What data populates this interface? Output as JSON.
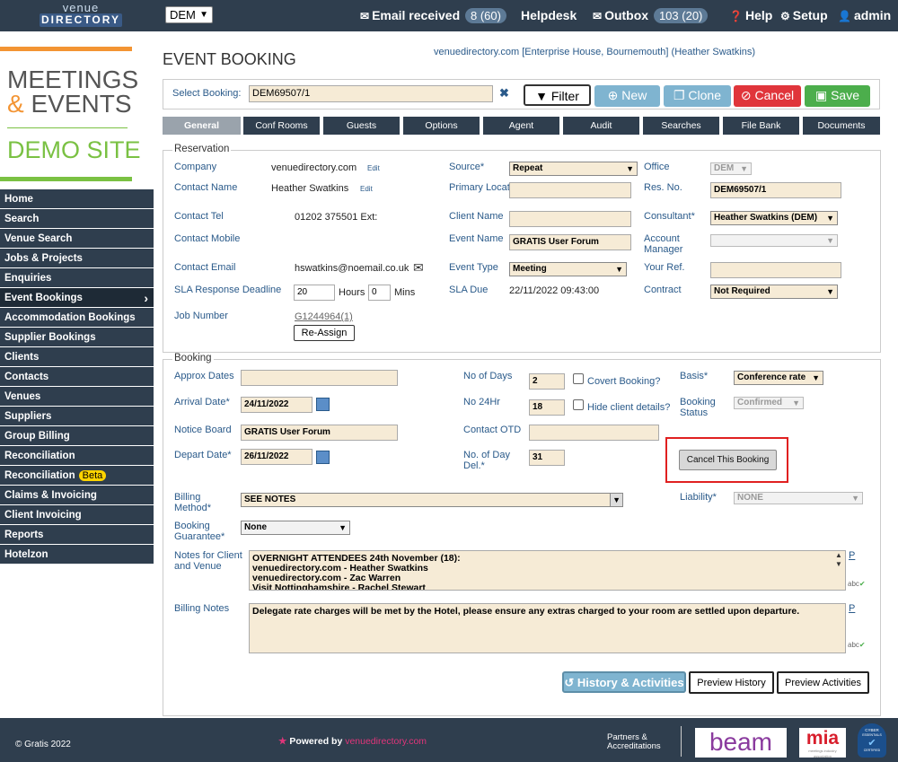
{
  "topbar": {
    "logo_line1": "venue",
    "logo_line2": "DIRECTORY",
    "site_select": "DEM",
    "email_label": "Email received",
    "email_count": "8 (60)",
    "helpdesk": "Helpdesk",
    "outbox_label": "Outbox",
    "outbox_count": "103 (20)",
    "help": "Help",
    "setup": "Setup",
    "admin": "admin"
  },
  "brand": {
    "line1": "MEETINGS",
    "amp": "&",
    "line2": "EVENTS",
    "demo": "DEMO SITE"
  },
  "sidebar": {
    "items": [
      {
        "label": "Home"
      },
      {
        "label": "Search"
      },
      {
        "label": "Venue Search"
      },
      {
        "label": "Jobs & Projects"
      },
      {
        "label": "Enquiries"
      },
      {
        "label": "Event Bookings"
      },
      {
        "label": "Accommodation Bookings"
      },
      {
        "label": "Supplier Bookings"
      },
      {
        "label": "Clients"
      },
      {
        "label": "Contacts"
      },
      {
        "label": "Venues"
      },
      {
        "label": "Suppliers"
      },
      {
        "label": "Group Billing"
      },
      {
        "label": "Reconciliation"
      },
      {
        "label": "Reconciliation"
      },
      {
        "label": "Claims & Invoicing"
      },
      {
        "label": "Client Invoicing"
      },
      {
        "label": "Reports"
      },
      {
        "label": "Hotelzon"
      }
    ],
    "beta": "Beta"
  },
  "page": {
    "title": "EVENT BOOKING",
    "location": "venuedirectory.com [Enterprise House, Bournemouth] (Heather Swatkins)"
  },
  "selbar": {
    "label": "Select Booking:",
    "value": "DEM69507/1",
    "filter": "Filter",
    "new": "New",
    "clone": "Clone",
    "cancel": "Cancel",
    "save": "Save"
  },
  "tabs": [
    "General",
    "Conf Rooms",
    "Guests",
    "Options",
    "Agent",
    "Audit",
    "Searches",
    "File Bank",
    "Documents"
  ],
  "reservation": {
    "legend": "Reservation",
    "company_label": "Company",
    "company": "venuedirectory.com",
    "edit": "Edit",
    "contact_name_label": "Contact Name",
    "contact_name": "Heather Swatkins",
    "contact_tel_label": "Contact Tel",
    "contact_tel": "01202 375501 Ext:",
    "contact_mobile_label": "Contact Mobile",
    "contact_email_label": "Contact Email",
    "contact_email": "hswatkins@noemail.co.uk",
    "sla_label": "SLA Response Deadline",
    "sla_hours": "20",
    "hours": "Hours",
    "sla_mins": "0",
    "mins": "Mins",
    "job_label": "Job Number",
    "job": "G1244964(1)",
    "reassign": "Re-Assign",
    "source_label": "Source*",
    "source": "Repeat",
    "primary_label": "Primary Location",
    "client_name_label": "Client Name",
    "event_name_label": "Event Name",
    "event_name": "GRATIS User Forum",
    "event_type_label": "Event Type",
    "event_type": "Meeting",
    "sla_due_label": "SLA Due",
    "sla_due": "22/11/2022 09:43:00",
    "office_label": "Office",
    "office": "DEM",
    "resno_label": "Res. No.",
    "resno": "DEM69507/1",
    "consultant_label": "Consultant*",
    "consultant": "Heather Swatkins (DEM)",
    "account_mgr_label": "Account Manager",
    "your_ref_label": "Your Ref.",
    "contract_label": "Contract",
    "contract": "Not Required"
  },
  "booking": {
    "legend": "Booking",
    "approx_label": "Approx Dates",
    "arrival_label": "Arrival Date*",
    "arrival": "24/11/2022",
    "notice_label": "Notice Board",
    "notice": "GRATIS User Forum",
    "depart_label": "Depart Date*",
    "depart": "26/11/2022",
    "days_label": "No of Days",
    "days": "2",
    "covert": "Covert Booking?",
    "n24_label": "No 24Hr",
    "n24": "18",
    "hide_client": "Hide client details?",
    "otd_label": "Contact OTD",
    "daydel_label": "No. of Day Del.*",
    "daydel": "31",
    "basis_label": "Basis*",
    "basis": "Conference rate",
    "status_label": "Booking Status",
    "status": "Confirmed",
    "cancel_booking": "Cancel This Booking",
    "billing_method_label": "Billing Method*",
    "billing_method": "SEE NOTES",
    "liability_label": "Liability*",
    "liability": "NONE",
    "guarantee_label": "Booking Guarantee*",
    "guarantee": "None",
    "notes_label": "Notes for Client and Venue",
    "notes_l1": "OVERNIGHT ATTENDEES 24th November (18):",
    "notes_l2": "venuedirectory.com - Heather Swatkins",
    "notes_l3": "venuedirectory.com - Zac Warren",
    "notes_l4": "Visit Nottinghamshire - Rachel Stewart",
    "billing_notes_label": "Billing Notes",
    "billing_notes": "Delegate rate charges will be met by the Hotel, please ensure any extras charged to your room are settled upon departure.",
    "p": "P",
    "abc": "abc"
  },
  "actions": {
    "history": "History & Activities",
    "preview_history": "Preview History",
    "preview_activities": "Preview Activities"
  },
  "footer": {
    "copyright": "© Gratis 2022",
    "powered": "Powered by",
    "powered_link": "venuedirectory.com",
    "partners": "Partners & Accreditations",
    "beam": "beam",
    "mia": "mia",
    "mia_sub": "meetings industry association",
    "cyber_top": "CYBER",
    "cyber_mid": "ESSENTIALS",
    "cyber_bot": "CERTIFIED"
  },
  "colors": {
    "navy": "#2f3e4e",
    "orange": "#f39433",
    "green": "#7ac143",
    "highlight": "#e02020"
  }
}
